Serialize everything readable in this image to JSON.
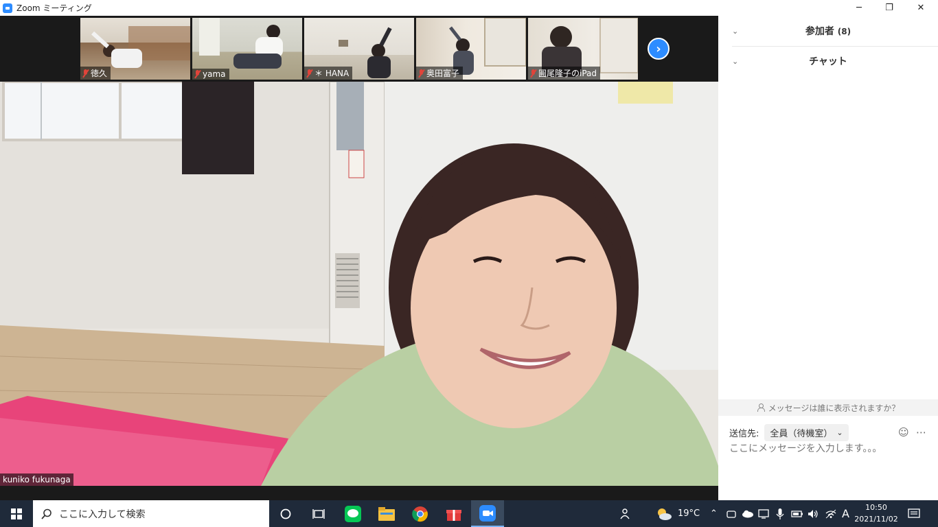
{
  "window": {
    "title": "Zoom ミーティング",
    "minimize_glyph": "─",
    "restore_glyph": "❐",
    "close_glyph": "✕"
  },
  "thumbnails": [
    {
      "name": "徳久",
      "muted": true
    },
    {
      "name": "yama",
      "muted": true
    },
    {
      "name": "＊ HANA",
      "muted": true
    },
    {
      "name": "奥田富子",
      "muted": true
    },
    {
      "name": "圓尾隆子のiPad",
      "muted": true
    }
  ],
  "main_video": {
    "speaker_name": "kuniko fukunaga"
  },
  "panel": {
    "participants_title": "参加者",
    "participants_count": "(8)",
    "chat_title": "チャット",
    "who_sees_text": "メッセージは誰に表示されますか？",
    "send_to_label": "送信先:",
    "send_to_value": "全員（待機室）",
    "message_placeholder": "ここにメッセージを入力します。。。"
  },
  "taskbar": {
    "search_placeholder": "ここに入力して検索",
    "weather_temp": "19°C",
    "ime_indicator": "A",
    "time": "10:50",
    "date": "2021/11/02"
  },
  "colors": {
    "zoom_blue": "#2d8cff",
    "taskbar_bg": "#1f2a3a",
    "mute_red": "#e0443a"
  }
}
